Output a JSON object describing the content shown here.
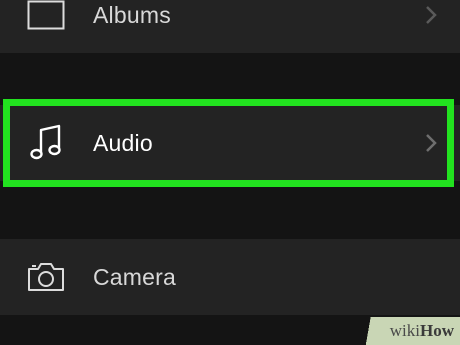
{
  "list": {
    "items": [
      {
        "label": "Albums",
        "icon": "album-square-icon"
      },
      {
        "label": "Audio",
        "icon": "music-note-icon",
        "highlighted": true
      },
      {
        "label": "Camera",
        "icon": "camera-icon"
      }
    ]
  },
  "watermark": {
    "prefix": "wiki",
    "suffix": "How"
  },
  "colors": {
    "highlight": "#22e21f",
    "row_bg": "#232323",
    "page_bg": "#141414"
  }
}
